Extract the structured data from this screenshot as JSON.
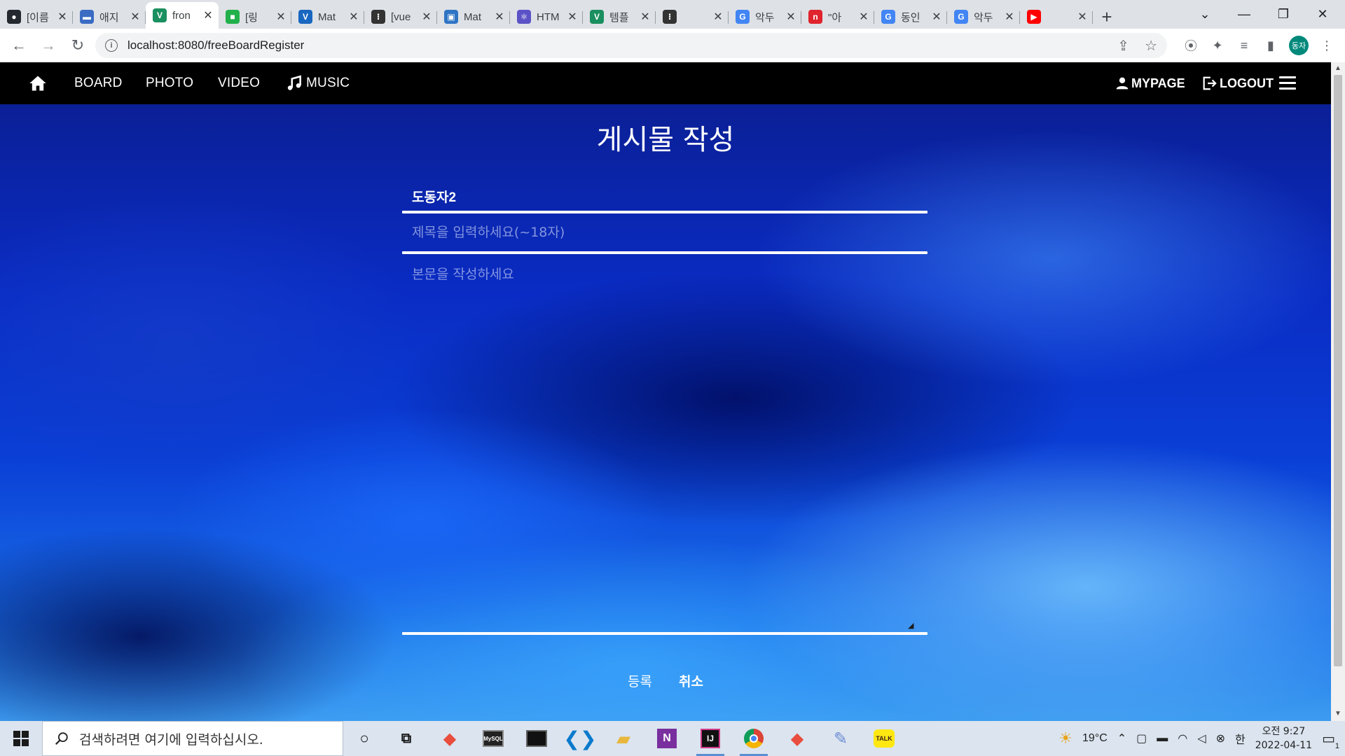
{
  "browser": {
    "tabs": [
      {
        "title": "[이름",
        "icon": "github-icon",
        "color": "#24292f",
        "glyph": "●"
      },
      {
        "title": "애지",
        "icon": "car-icon",
        "color": "#3b6cc4",
        "glyph": "▬"
      },
      {
        "title": "fron",
        "icon": "vue-icon",
        "color": "#1a8f5f",
        "glyph": "V",
        "active": true
      },
      {
        "title": "[링",
        "icon": "green-app-icon",
        "color": "#21b04a",
        "glyph": "■"
      },
      {
        "title": "Mat",
        "icon": "vuetify-icon",
        "color": "#1867c0",
        "glyph": "V"
      },
      {
        "title": "[vue",
        "icon": "dots-icon",
        "color": "#333333",
        "glyph": "⁝"
      },
      {
        "title": "Mat",
        "icon": "material-icon",
        "color": "#2e74c4",
        "glyph": "▣"
      },
      {
        "title": "HTM",
        "icon": "react-icon",
        "color": "#5b52c7",
        "glyph": "⚛"
      },
      {
        "title": "템플",
        "icon": "vue-icon",
        "color": "#1a8f5f",
        "glyph": "V"
      },
      {
        "title": "",
        "icon": "dots-icon",
        "color": "#333333",
        "glyph": "⁝"
      },
      {
        "title": "악두",
        "icon": "google-icon",
        "color": "#4285f4",
        "glyph": "G"
      },
      {
        "title": "\"아",
        "icon": "red-n-icon",
        "color": "#e0242d",
        "glyph": "n"
      },
      {
        "title": "동인",
        "icon": "google-icon",
        "color": "#4285f4",
        "glyph": "G"
      },
      {
        "title": "악두",
        "icon": "google-icon",
        "color": "#4285f4",
        "glyph": "G"
      },
      {
        "title": "",
        "icon": "youtube-icon",
        "color": "#ff0000",
        "glyph": "▶"
      }
    ],
    "url": "localhost:8080/freeBoardRegister",
    "profile_initials": "동자"
  },
  "nav": {
    "links": [
      "BOARD",
      "PHOTO",
      "VIDEO",
      "MUSIC"
    ],
    "mypage": "MYPAGE",
    "logout": "LOGOUT"
  },
  "form": {
    "heading": "게시물 작성",
    "author": "도동자2",
    "title_placeholder": "제목을 입력하세요(~18자)",
    "body_placeholder": "본문을 작성하세요",
    "submit_label": "등록",
    "cancel_label": "취소"
  },
  "taskbar": {
    "search_placeholder": "검색하려면 여기에 입력하십시오.",
    "weather": "19°C",
    "ime": "한",
    "time": "오전 9:27",
    "date": "2022-04-11",
    "notification_count": "1"
  },
  "colors": {
    "navbar": "#000000",
    "text": "#ffffff",
    "accent_blue": "#0a3fd6"
  }
}
